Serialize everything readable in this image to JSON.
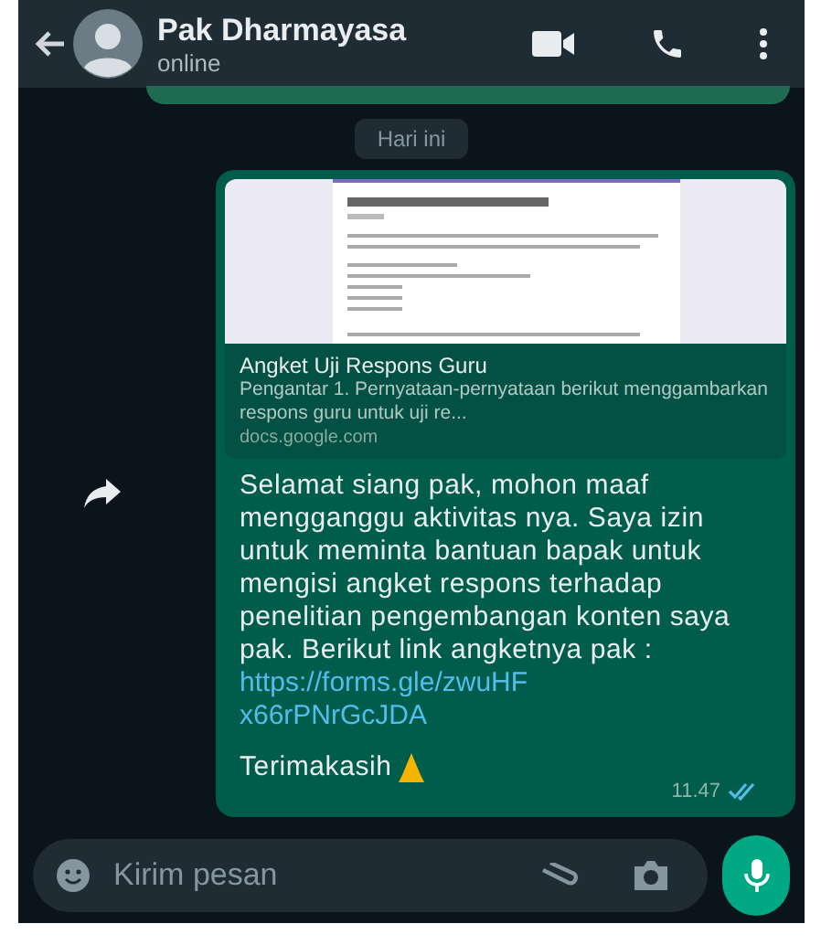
{
  "header": {
    "title": "Pak Dharmayasa",
    "status": "online"
  },
  "date_chip": "Hari ini",
  "message": {
    "link_preview": {
      "title": "Angket Uji Respons Guru",
      "description": "Pengantar 1. Pernyataan-pernyataan berikut menggambarkan respons guru untuk uji re...",
      "domain": "docs.google.com"
    },
    "body": "Selamat siang pak, mohon maaf mengganggu aktivitas nya. Saya izin untuk meminta bantuan bapak untuk mengisi angket respons terhadap penelitian pengembangan konten saya pak. Berikut link angketnya pak :",
    "link": "https://forms.gle/zwuHFx66rPNrGcJDA",
    "closing": "Terimakasih",
    "time": "11.47",
    "read": true
  },
  "composer": {
    "placeholder": "Kirim pesan"
  }
}
